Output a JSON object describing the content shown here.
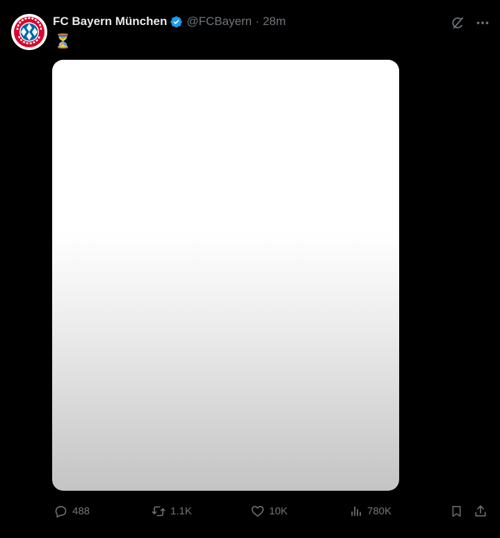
{
  "tweet": {
    "display_name": "FC Bayern München",
    "handle": "@FCBayern",
    "separator": "·",
    "time": "28m",
    "verified": true,
    "text": "⏳",
    "avatar_icon": "fc-bayern-crest-icon",
    "avatar_lettering": "FC BAYERN MÜNCHEN",
    "media_alt": "Image"
  },
  "header_actions": {
    "grok_icon": "grok-icon",
    "more_icon": "more-icon"
  },
  "engagement": {
    "replies": "488",
    "reposts": "1.1K",
    "likes": "10K",
    "views": "780K"
  },
  "colors": {
    "background": "#000000",
    "primary_text": "#e7e9ea",
    "secondary_text": "#71767b",
    "verified_blue": "#1d9bf0",
    "bayern_red": "#dc052d",
    "bayern_blue": "#0066b2"
  }
}
